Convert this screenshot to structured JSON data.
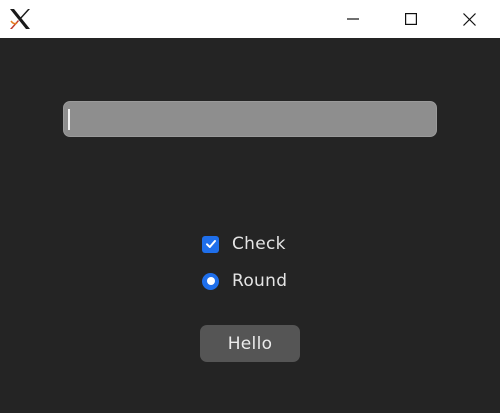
{
  "window": {
    "logo_icon": "x-window-logo-icon",
    "controls": {
      "minimize_icon": "minimize-icon",
      "maximize_icon": "maximize-icon",
      "close_icon": "close-icon"
    }
  },
  "form": {
    "text_input_value": "",
    "checkbox": {
      "label": "Check",
      "checked": true
    },
    "radio": {
      "label": "Round",
      "selected": true
    },
    "button_label": "Hello"
  },
  "colors": {
    "background": "#242424",
    "accent": "#1f6feb",
    "input_bg": "#8e8e8e",
    "button_bg": "#555555"
  }
}
